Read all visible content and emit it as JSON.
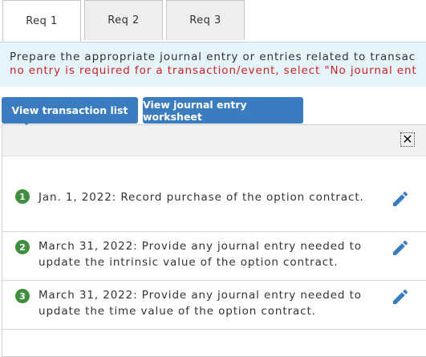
{
  "tabs": [
    {
      "label": "Req 1"
    },
    {
      "label": "Req 2"
    },
    {
      "label": "Req 3"
    }
  ],
  "instructions": {
    "line1": "Prepare the appropriate journal entry or entries related to transac",
    "line2": "no entry is required for a transaction/event, select \"No journal ent"
  },
  "buttons": {
    "transaction_list": "View transaction list",
    "journal_worksheet": "View journal entry worksheet"
  },
  "panel": {
    "close_symbol": "✕"
  },
  "transactions": [
    {
      "number": "1",
      "text": "Jan. 1, 2022: Record purchase of the option contract."
    },
    {
      "number": "2",
      "text": "March 31, 2022: Provide any journal entry needed to update the intrinsic value of the option contract."
    },
    {
      "number": "3",
      "text": "March 31, 2022: Provide any journal entry needed to update the time value of the option contract."
    }
  ],
  "colors": {
    "accent_blue": "#3b7bc0",
    "instruction_bg": "#e5f3fb",
    "warning_red": "#cc2222",
    "step_green": "#3f8f3f"
  },
  "icons": {
    "edit": "pencil-icon",
    "close": "close-icon"
  }
}
